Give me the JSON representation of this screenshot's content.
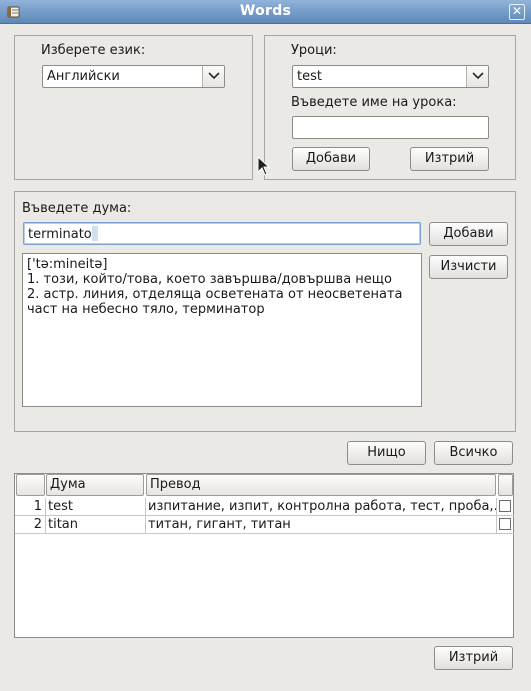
{
  "window": {
    "title": "Words",
    "app_icon": "book-icon",
    "close_icon": "close-icon"
  },
  "language": {
    "label": "Изберете език:",
    "selected": "Английски"
  },
  "lessons": {
    "label": "Уроци:",
    "selected": "test",
    "name_label": "Въведете име на урока:",
    "name_value": "",
    "add_label": "Добави",
    "delete_label": "Изтрий"
  },
  "word": {
    "label": "Въведете дума:",
    "value": "terminato",
    "add_label": "Добави",
    "clear_label": "Изчисти",
    "definition": "['tə:mineitə]\n1. този, който/това, което завършва/довършва нещо\n2. астр. линия, отделяща осветената от неосветената\nчаст на небесно тяло, терминатор"
  },
  "selection": {
    "none_label": "Нищо",
    "all_label": "Всичко"
  },
  "table": {
    "headers": {
      "num": "",
      "word": "Дума",
      "translation": "Превод",
      "check": ""
    },
    "rows": [
      {
        "num": "1",
        "word": "test",
        "translation": "изпитание, изпит, контролна работа, тест, проба,...",
        "checked": false
      },
      {
        "num": "2",
        "word": "titan",
        "translation": "титан, гигант, титан",
        "checked": false
      }
    ]
  },
  "footer": {
    "delete_label": "Изтрий"
  }
}
